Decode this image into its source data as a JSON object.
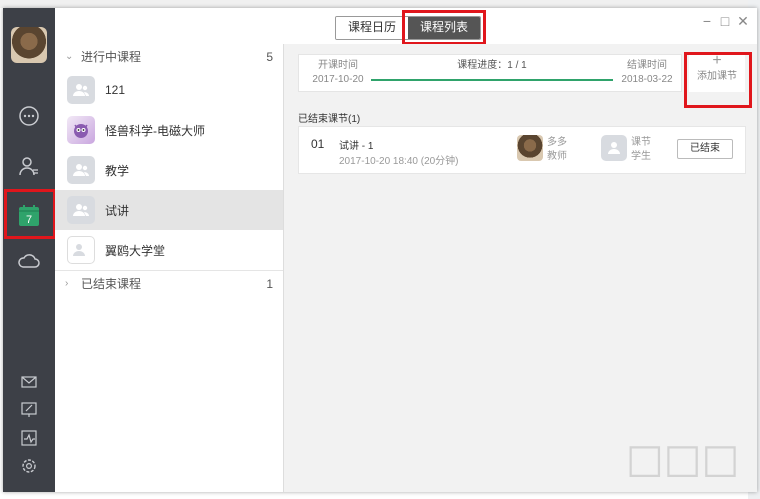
{
  "window": {
    "tabs": [
      {
        "label": "课程日历",
        "active": false
      },
      {
        "label": "课程列表",
        "active": true
      }
    ],
    "controls": [
      "−",
      "□",
      "✕"
    ]
  },
  "sidebar_rail": {
    "icons": [
      "chat-icon",
      "contacts-icon",
      "calendar-icon",
      "cloud-icon",
      "mail-icon",
      "whiteboard-icon",
      "stats-icon",
      "settings-icon"
    ],
    "calendar_day": "7",
    "highlight_color": "#e0161c",
    "accent_green": "#2fa36b"
  },
  "course_list": {
    "ongoing": {
      "label": "进行中课程",
      "count": "5",
      "items": [
        {
          "name": "121",
          "selected": false
        },
        {
          "name": "怪兽科学-电磁大师",
          "selected": false
        },
        {
          "name": "教学",
          "selected": false
        },
        {
          "name": "试讲",
          "selected": true
        },
        {
          "name": "翼鸥大学堂",
          "selected": false
        }
      ]
    },
    "ended": {
      "label": "已结束课程",
      "count": "1"
    }
  },
  "progress": {
    "start_label": "开课时间",
    "start_date": "2017-10-20",
    "progress_label": "课程进度：",
    "progress_value": "1 / 1",
    "progress_fraction": 1.0,
    "end_label": "结课时间",
    "end_date": "2018-03-22"
  },
  "add_lesson": {
    "icon": "+",
    "label": "添加课节"
  },
  "ended_lessons": {
    "title": "已结束课节(1)",
    "items": [
      {
        "index": "01",
        "title": "试讲 - 1",
        "time": "2017-10-20 18:40 (20分钟)",
        "teacher_name": "多多",
        "teacher_role": "教师",
        "student_name": "课节",
        "student_role": "学生",
        "status": "已结束"
      }
    ]
  }
}
